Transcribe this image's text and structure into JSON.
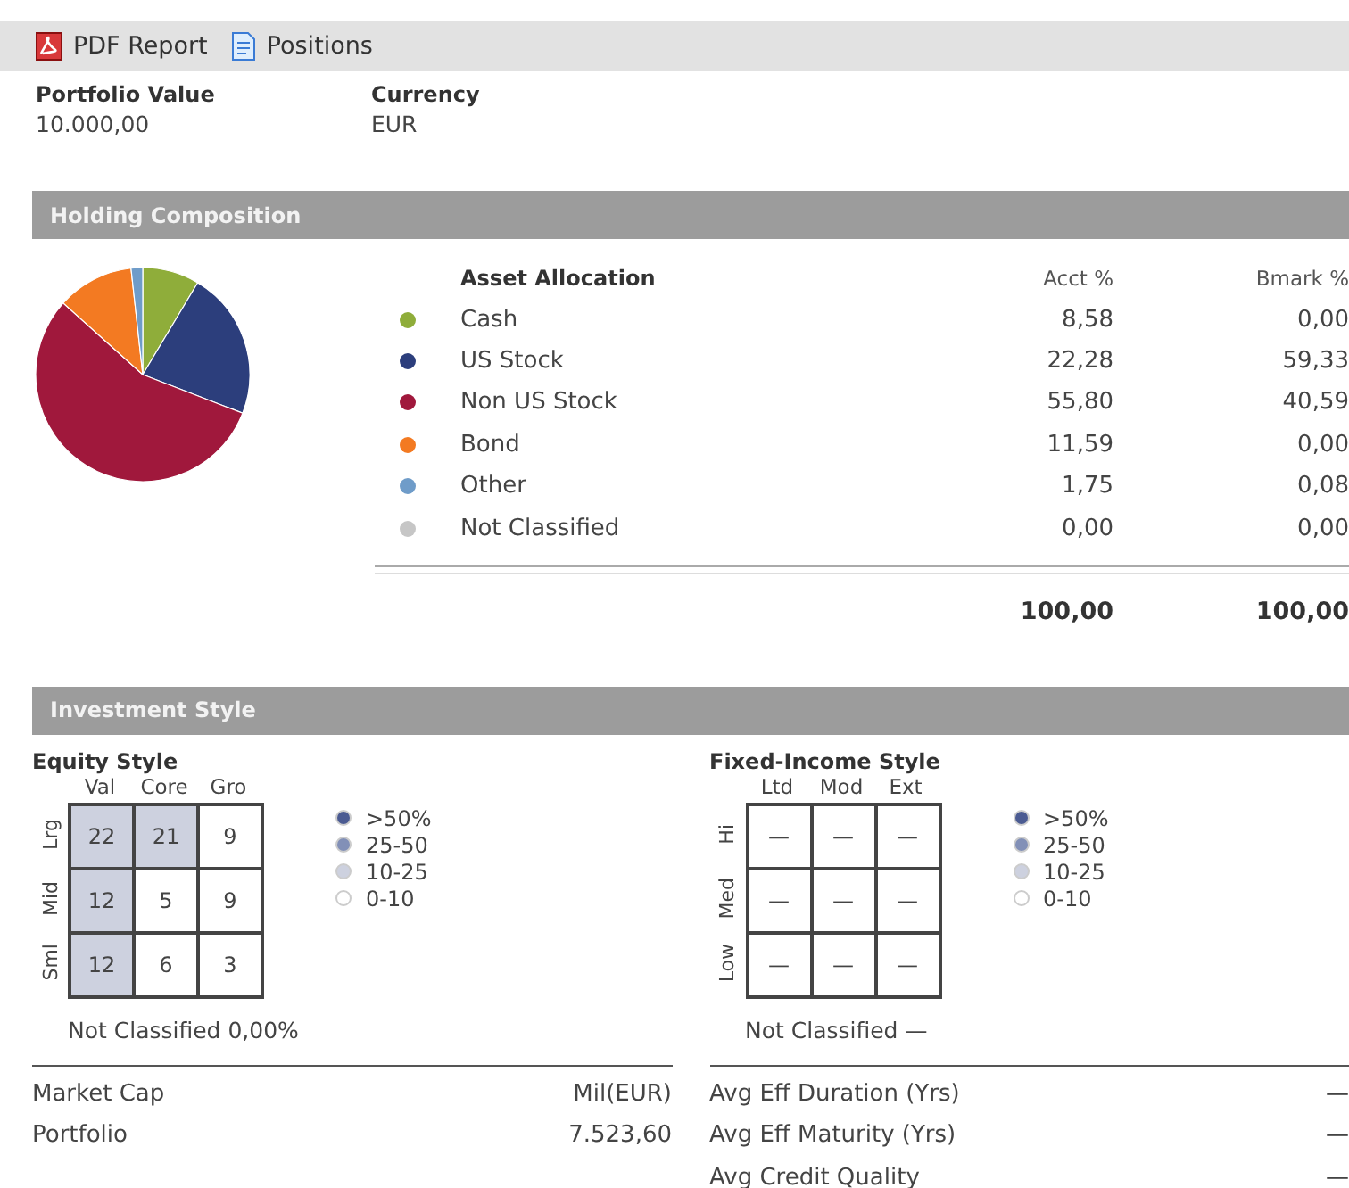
{
  "toolbar": [
    {
      "kind": "pdf",
      "label": "PDF Report"
    },
    {
      "kind": "doc",
      "label": "Positions"
    }
  ],
  "summary": [
    {
      "label": "Portfolio Value",
      "value": "10.000,00"
    },
    {
      "label": "Currency",
      "value": "EUR"
    }
  ],
  "holding_composition": {
    "title": "Holding Composition",
    "columns": [
      "Asset Allocation",
      "Acct %",
      "Bmark %"
    ],
    "rows": [
      {
        "name": "Cash",
        "color": "#8fad3a",
        "acct": "8,58",
        "bmark": "0,00"
      },
      {
        "name": "US Stock",
        "color": "#2c3e7c",
        "acct": "22,28",
        "bmark": "59,33"
      },
      {
        "name": "Non US Stock",
        "color": "#a0183c",
        "acct": "55,80",
        "bmark": "40,59"
      },
      {
        "name": "Bond",
        "color": "#f37a22",
        "acct": "11,59",
        "bmark": "0,00"
      },
      {
        "name": "Other",
        "color": "#6f9cc9",
        "acct": "1,75",
        "bmark": "0,08"
      },
      {
        "name": "Not Classified",
        "color": "#c6c6c6",
        "acct": "0,00",
        "bmark": "0,00"
      }
    ],
    "total": {
      "acct": "100,00",
      "bmark": "100,00"
    },
    "chart_data": {
      "type": "pie",
      "values": [
        8.58,
        22.28,
        55.8,
        11.59,
        1.75,
        0
      ]
    }
  },
  "investment_style": {
    "title": "Investment Style",
    "panels": [
      {
        "title": "Equity Style",
        "columns": [
          "Val",
          "Core",
          "Gro"
        ],
        "rows": [
          "Lrg",
          "Mid",
          "Sml"
        ],
        "cells": [
          [
            {
              "value": "22",
              "color": "#cdd1df"
            },
            {
              "value": "21",
              "color": "#cdd1df"
            },
            {
              "value": "9",
              "color": "#ffffff"
            }
          ],
          [
            {
              "value": "12",
              "color": "#cdd1df"
            },
            {
              "value": "5",
              "color": "#ffffff"
            },
            {
              "value": "9",
              "color": "#ffffff"
            }
          ],
          [
            {
              "value": "12",
              "color": "#cdd1df"
            },
            {
              "value": "6",
              "color": "#ffffff"
            },
            {
              "value": "3",
              "color": "#ffffff"
            }
          ]
        ],
        "legend": [
          {
            "label": ">50%",
            "color": "#4b5b92"
          },
          {
            "label": "25-50",
            "color": "#8290b7"
          },
          {
            "label": "10-25",
            "color": "#cdd1df"
          },
          {
            "label": "0-10",
            "color": "#ffffff"
          }
        ],
        "not_classified": "Not Classified 0,00%",
        "stats_header": {
          "label": "Market Cap",
          "value": "Mil(EUR)"
        },
        "stats": [
          {
            "label": "Portfolio",
            "value": "7.523,60"
          }
        ]
      },
      {
        "title": "Fixed-Income Style",
        "columns": [
          "Ltd",
          "Mod",
          "Ext"
        ],
        "rows": [
          "Hi",
          "Med",
          "Low"
        ],
        "cells": [
          [
            {
              "value": "—",
              "color": "#ffffff"
            },
            {
              "value": "—",
              "color": "#ffffff"
            },
            {
              "value": "—",
              "color": "#ffffff"
            }
          ],
          [
            {
              "value": "—",
              "color": "#ffffff"
            },
            {
              "value": "—",
              "color": "#ffffff"
            },
            {
              "value": "—",
              "color": "#ffffff"
            }
          ],
          [
            {
              "value": "—",
              "color": "#ffffff"
            },
            {
              "value": "—",
              "color": "#ffffff"
            },
            {
              "value": "—",
              "color": "#ffffff"
            }
          ]
        ],
        "legend": [
          {
            "label": ">50%",
            "color": "#4b5b92"
          },
          {
            "label": "25-50",
            "color": "#8290b7"
          },
          {
            "label": "10-25",
            "color": "#cdd1df"
          },
          {
            "label": "0-10",
            "color": "#ffffff"
          }
        ],
        "not_classified": "Not Classified —",
        "stats": [
          {
            "label": "Avg Eff Duration (Yrs)",
            "value": "—"
          },
          {
            "label": "Avg Eff Maturity (Yrs)",
            "value": "—"
          },
          {
            "label": "Avg Credit Quality",
            "value": "—"
          }
        ]
      }
    ]
  }
}
